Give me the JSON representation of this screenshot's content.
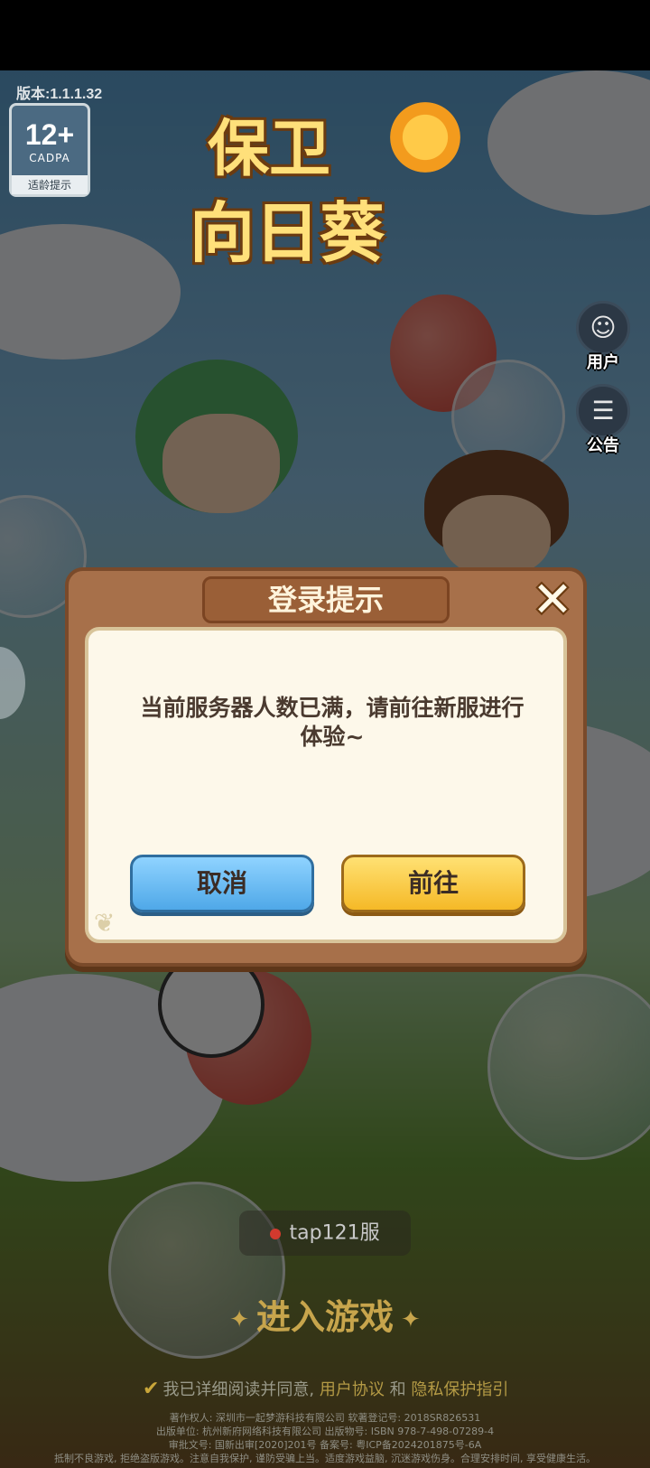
{
  "version": "版本:1.1.1.32",
  "age_badge": {
    "age": "12+",
    "org": "CADPA",
    "tip": "适龄提示"
  },
  "logo": {
    "line1": "保卫",
    "line2": "向日葵"
  },
  "side_buttons": [
    {
      "label": "用户",
      "icon": "user-icon"
    },
    {
      "label": "公告",
      "icon": "notice-icon"
    }
  ],
  "dialog": {
    "title": "登录提示",
    "message": "当前服务器人数已满，请前往新服进行体验~",
    "cancel_label": "取消",
    "confirm_label": "前往",
    "close_glyph": "✕"
  },
  "server": {
    "name": "tap121服"
  },
  "enter_game": "进入游戏",
  "agreement": {
    "checkbox": "✔",
    "prefix": "我已详细阅读并同意,",
    "user_agreement": "用户协议",
    "and": "和",
    "privacy": "隐私保护指引"
  },
  "footer": {
    "line1": "著作权人: 深圳市一起梦游科技有限公司  软著登记号: 2018SR826531",
    "line2": "出版单位: 杭州新府网络科技有限公司  出版物号: ISBN 978-7-498-07289-4",
    "line3": "审批文号: 国新出审[2020]201号  备案号: 粤ICP备2024201875号-6A",
    "line4": "抵制不良游戏, 拒绝盗版游戏。注意自我保护, 谨防受骗上当。适度游戏益脑, 沉迷游戏伤身。合理安排时间, 享受健康生活。"
  }
}
